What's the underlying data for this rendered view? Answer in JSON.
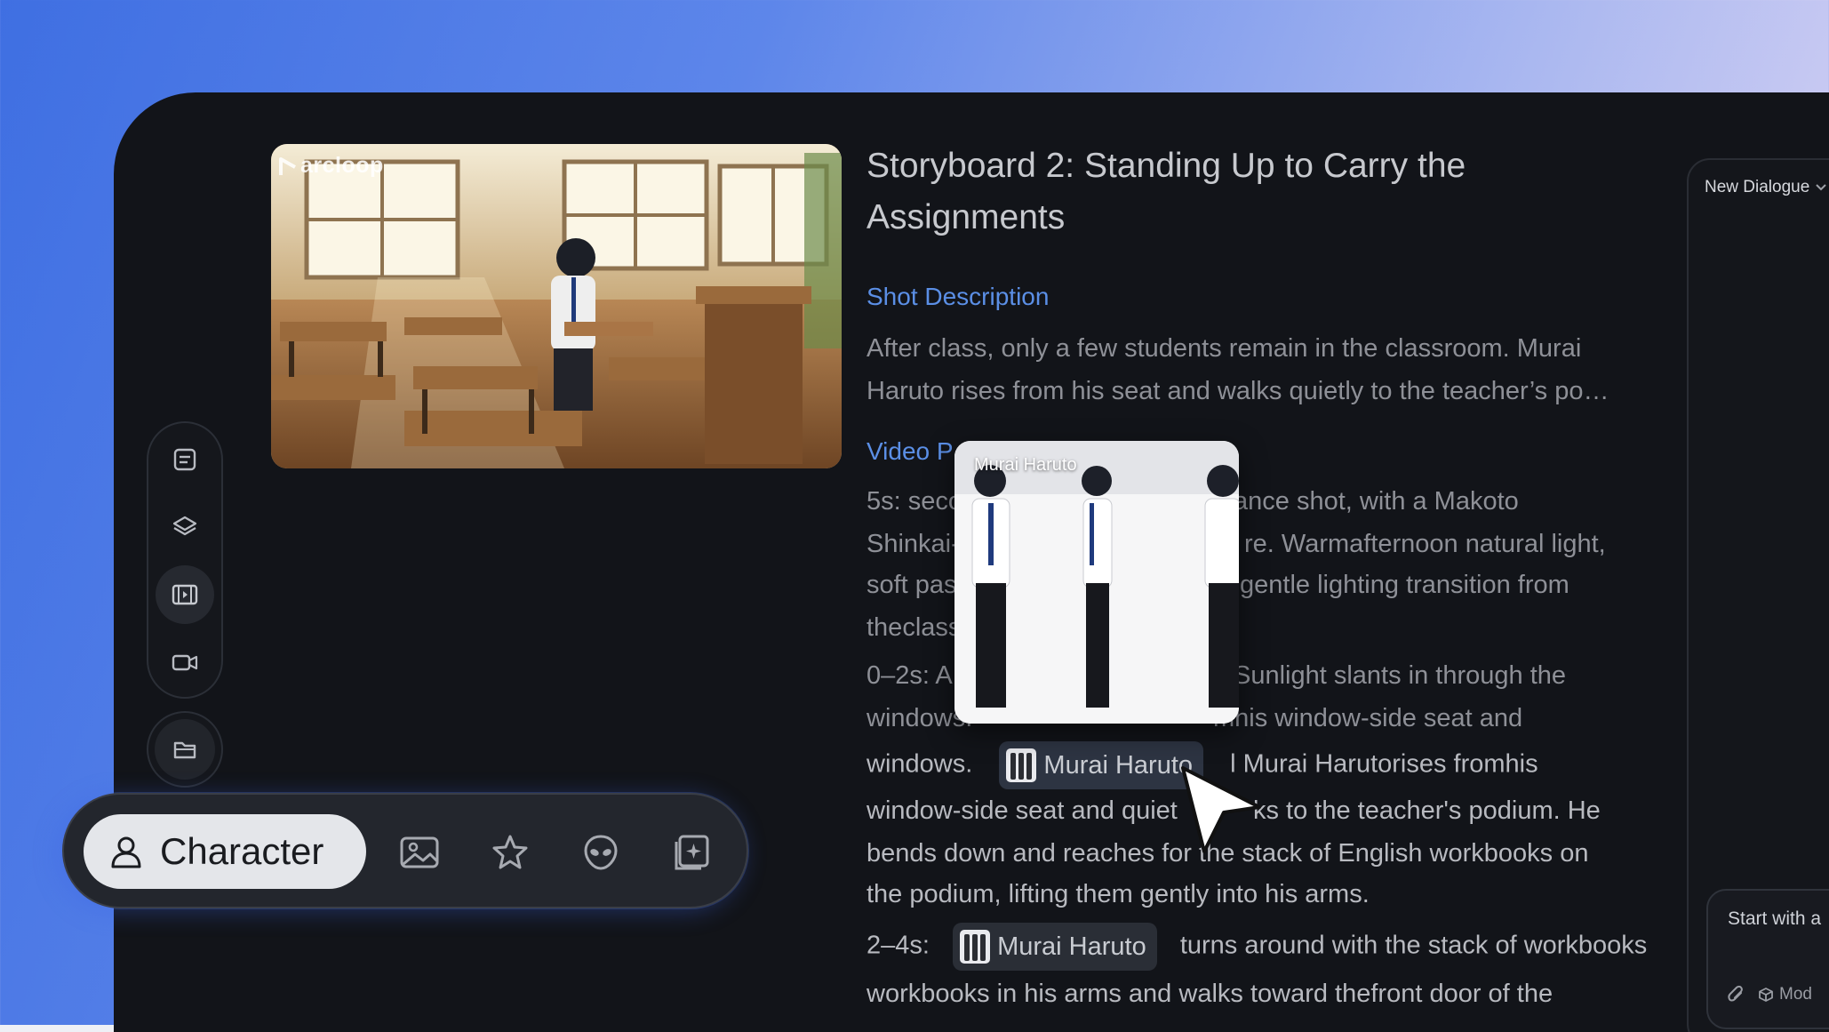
{
  "brand": {
    "logo_text": "arcloop"
  },
  "storyboard": {
    "title": "Storyboard 2: Standing Up to Carry the Assignments",
    "shot_description_label": "Shot Description",
    "shot_description_text": "After class, only a few students remain in the classroom. Murai Haruto rises from his seat and walks quietly to the teacher’s po…",
    "video_prompt_label": "Video P",
    "video_prompt_lines": [
      "5s: seco",
      "ance shot, with a Makoto",
      "Shinkai-",
      "re. Warmafternoon natural light,",
      "soft pas",
      "gentle lighting transition from",
      "theclass"
    ],
    "beat_1_prefix": "0–2s: A",
    "beat_1_line_a": "Sunlight slants in through the",
    "beat_1_line_b_start": "windows.",
    "beat_1_line_b_end": "mhis window-side seat and",
    "beat_1_line_c_start": "windows.",
    "beat_1_chip": "Murai Haruto",
    "beat_1_line_c_end": "l Murai Harutorises fromhis",
    "beat_1_line_d_start": "window-side seat and quiet",
    "beat_1_line_d_end": "ks to the teacher's podium. He",
    "beat_1_line_e": "bends down and reaches for the stack of English workbooks on",
    "beat_1_line_f": "the podium, lifting them gently into his arms.",
    "beat_2_prefix": "2–4s:",
    "beat_2_chip": "Murai Haruto",
    "beat_2_text": "turns around with the stack of workbooks",
    "beat_2_line_b": "workbooks in his arms and walks toward thefront door of the"
  },
  "character_preview": {
    "name": "Murai Haruto"
  },
  "toolbar": {
    "active_label": "Character",
    "icons": [
      "image-icon",
      "star-icon",
      "alien-icon",
      "add-frame-icon"
    ]
  },
  "rail": {
    "icons": [
      "document-icon",
      "layers-icon",
      "film-icon",
      "video-camera-icon",
      "folder-icon"
    ]
  },
  "chat": {
    "dropdown_label": "New Dialogue",
    "input_placeholder": "Start with a",
    "model_label": "Mod"
  },
  "colors": {
    "accent": "#5b8fe6",
    "background": "#121419",
    "active_pill": "#e4e6ea"
  }
}
